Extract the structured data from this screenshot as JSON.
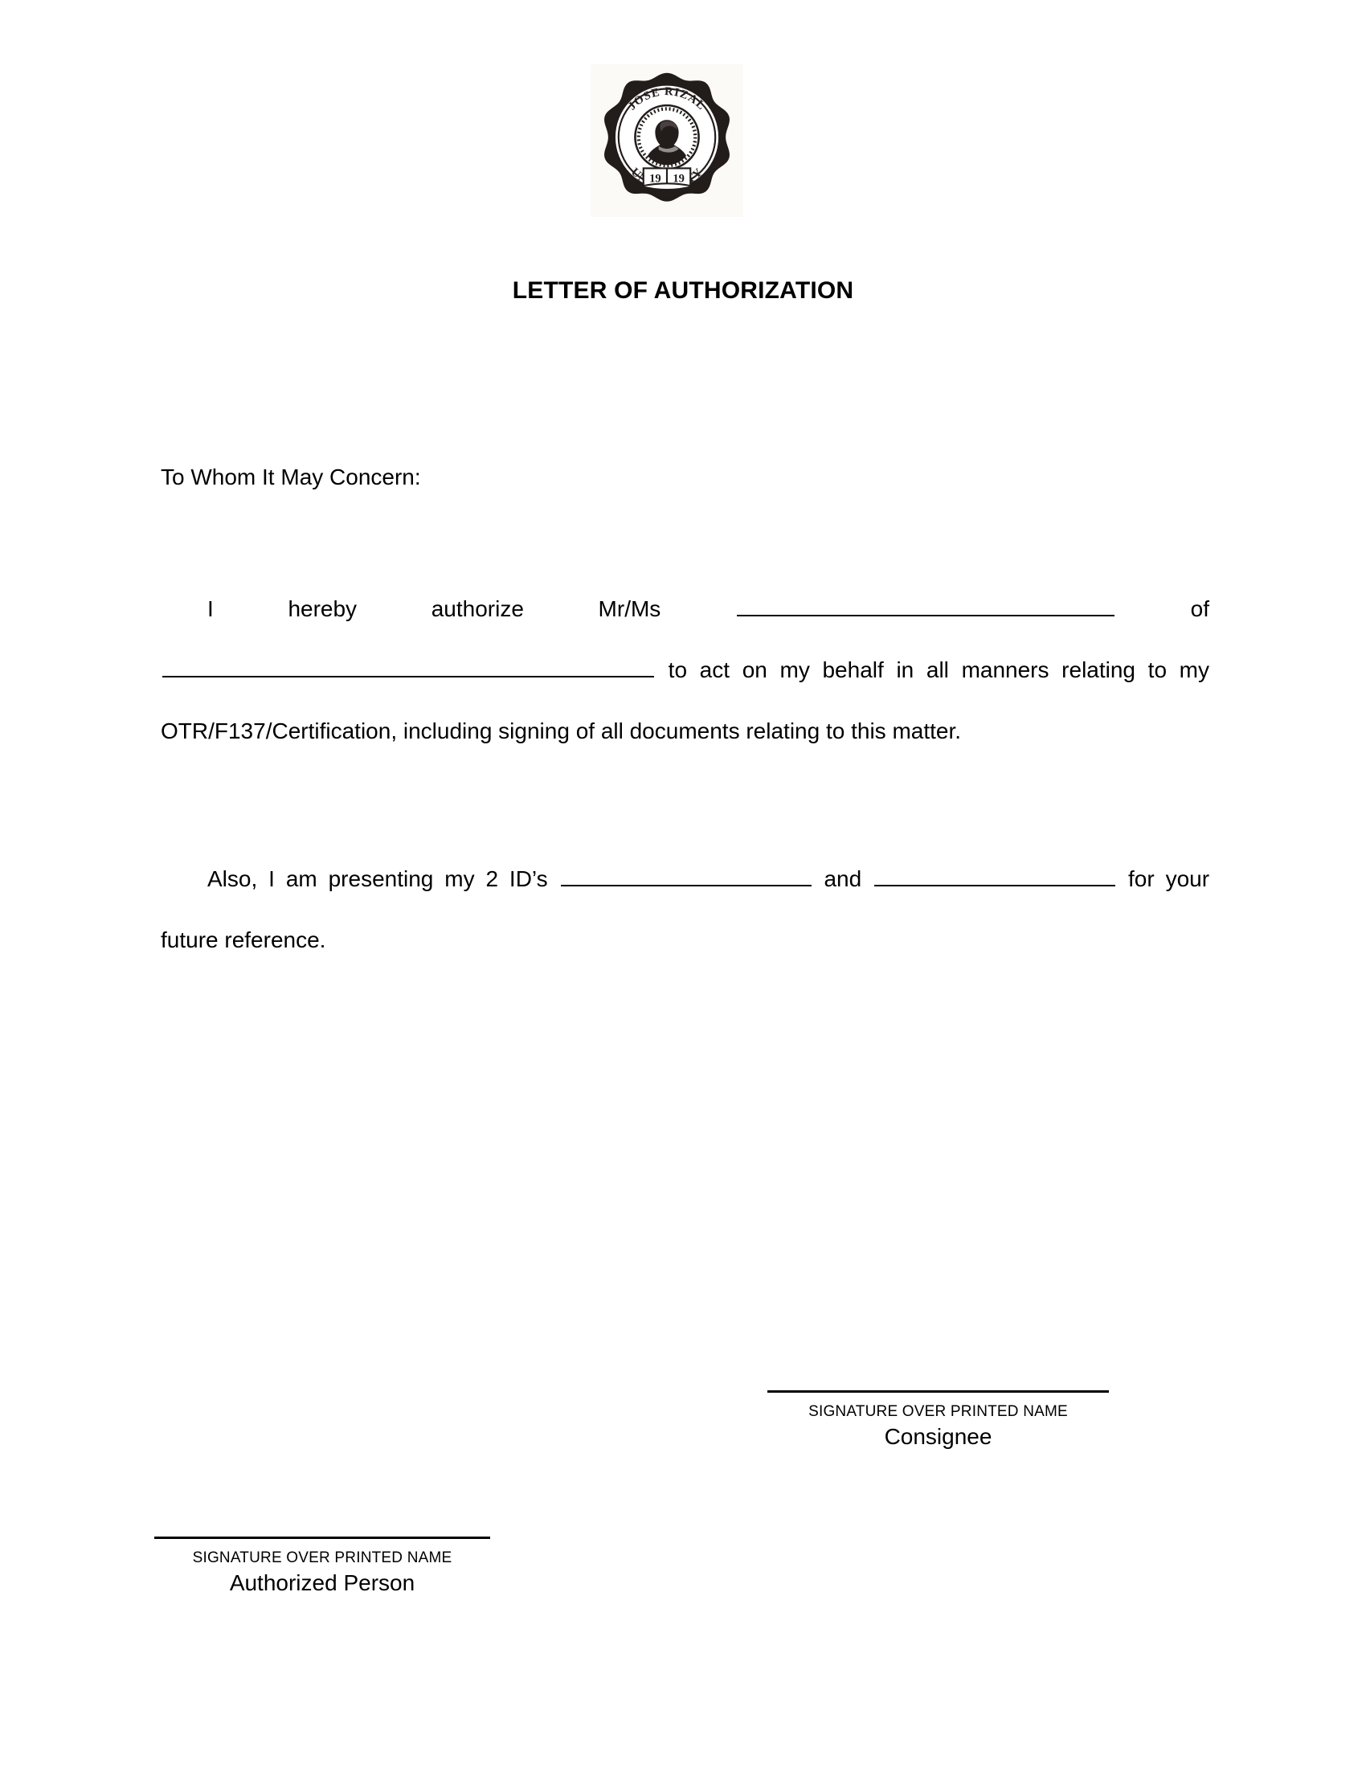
{
  "document": {
    "title": "LETTER OF AUTHORIZATION",
    "salutation": "To Whom It May Concern:",
    "logo": {
      "icon": "jose-rizal-university-seal",
      "outer_text": "JOSE RIZAL UNIVERSITY",
      "year": "1919"
    },
    "paragraphs": {
      "authorization": {
        "segment_1": "I hereby authorize Mr/Ms",
        "segment_2": "of",
        "segment_3": "to act on my behalf in all manners relating to my OTR/F137/Certification, including signing of all documents relating to this matter."
      },
      "identification": {
        "segment_1": "Also, I am presenting my 2 ID’s",
        "segment_2": "and",
        "segment_3": "for your future reference."
      }
    },
    "signatures": [
      {
        "caption": "SIGNATURE OVER PRINTED NAME",
        "role": "Consignee"
      },
      {
        "caption": "SIGNATURE OVER PRINTED NAME",
        "role": "Authorized Person"
      }
    ],
    "colors": {
      "text": "#000000",
      "page_background": "#ffffff",
      "logo_background": "#fbfaf6",
      "seal": "#221c1b"
    }
  }
}
